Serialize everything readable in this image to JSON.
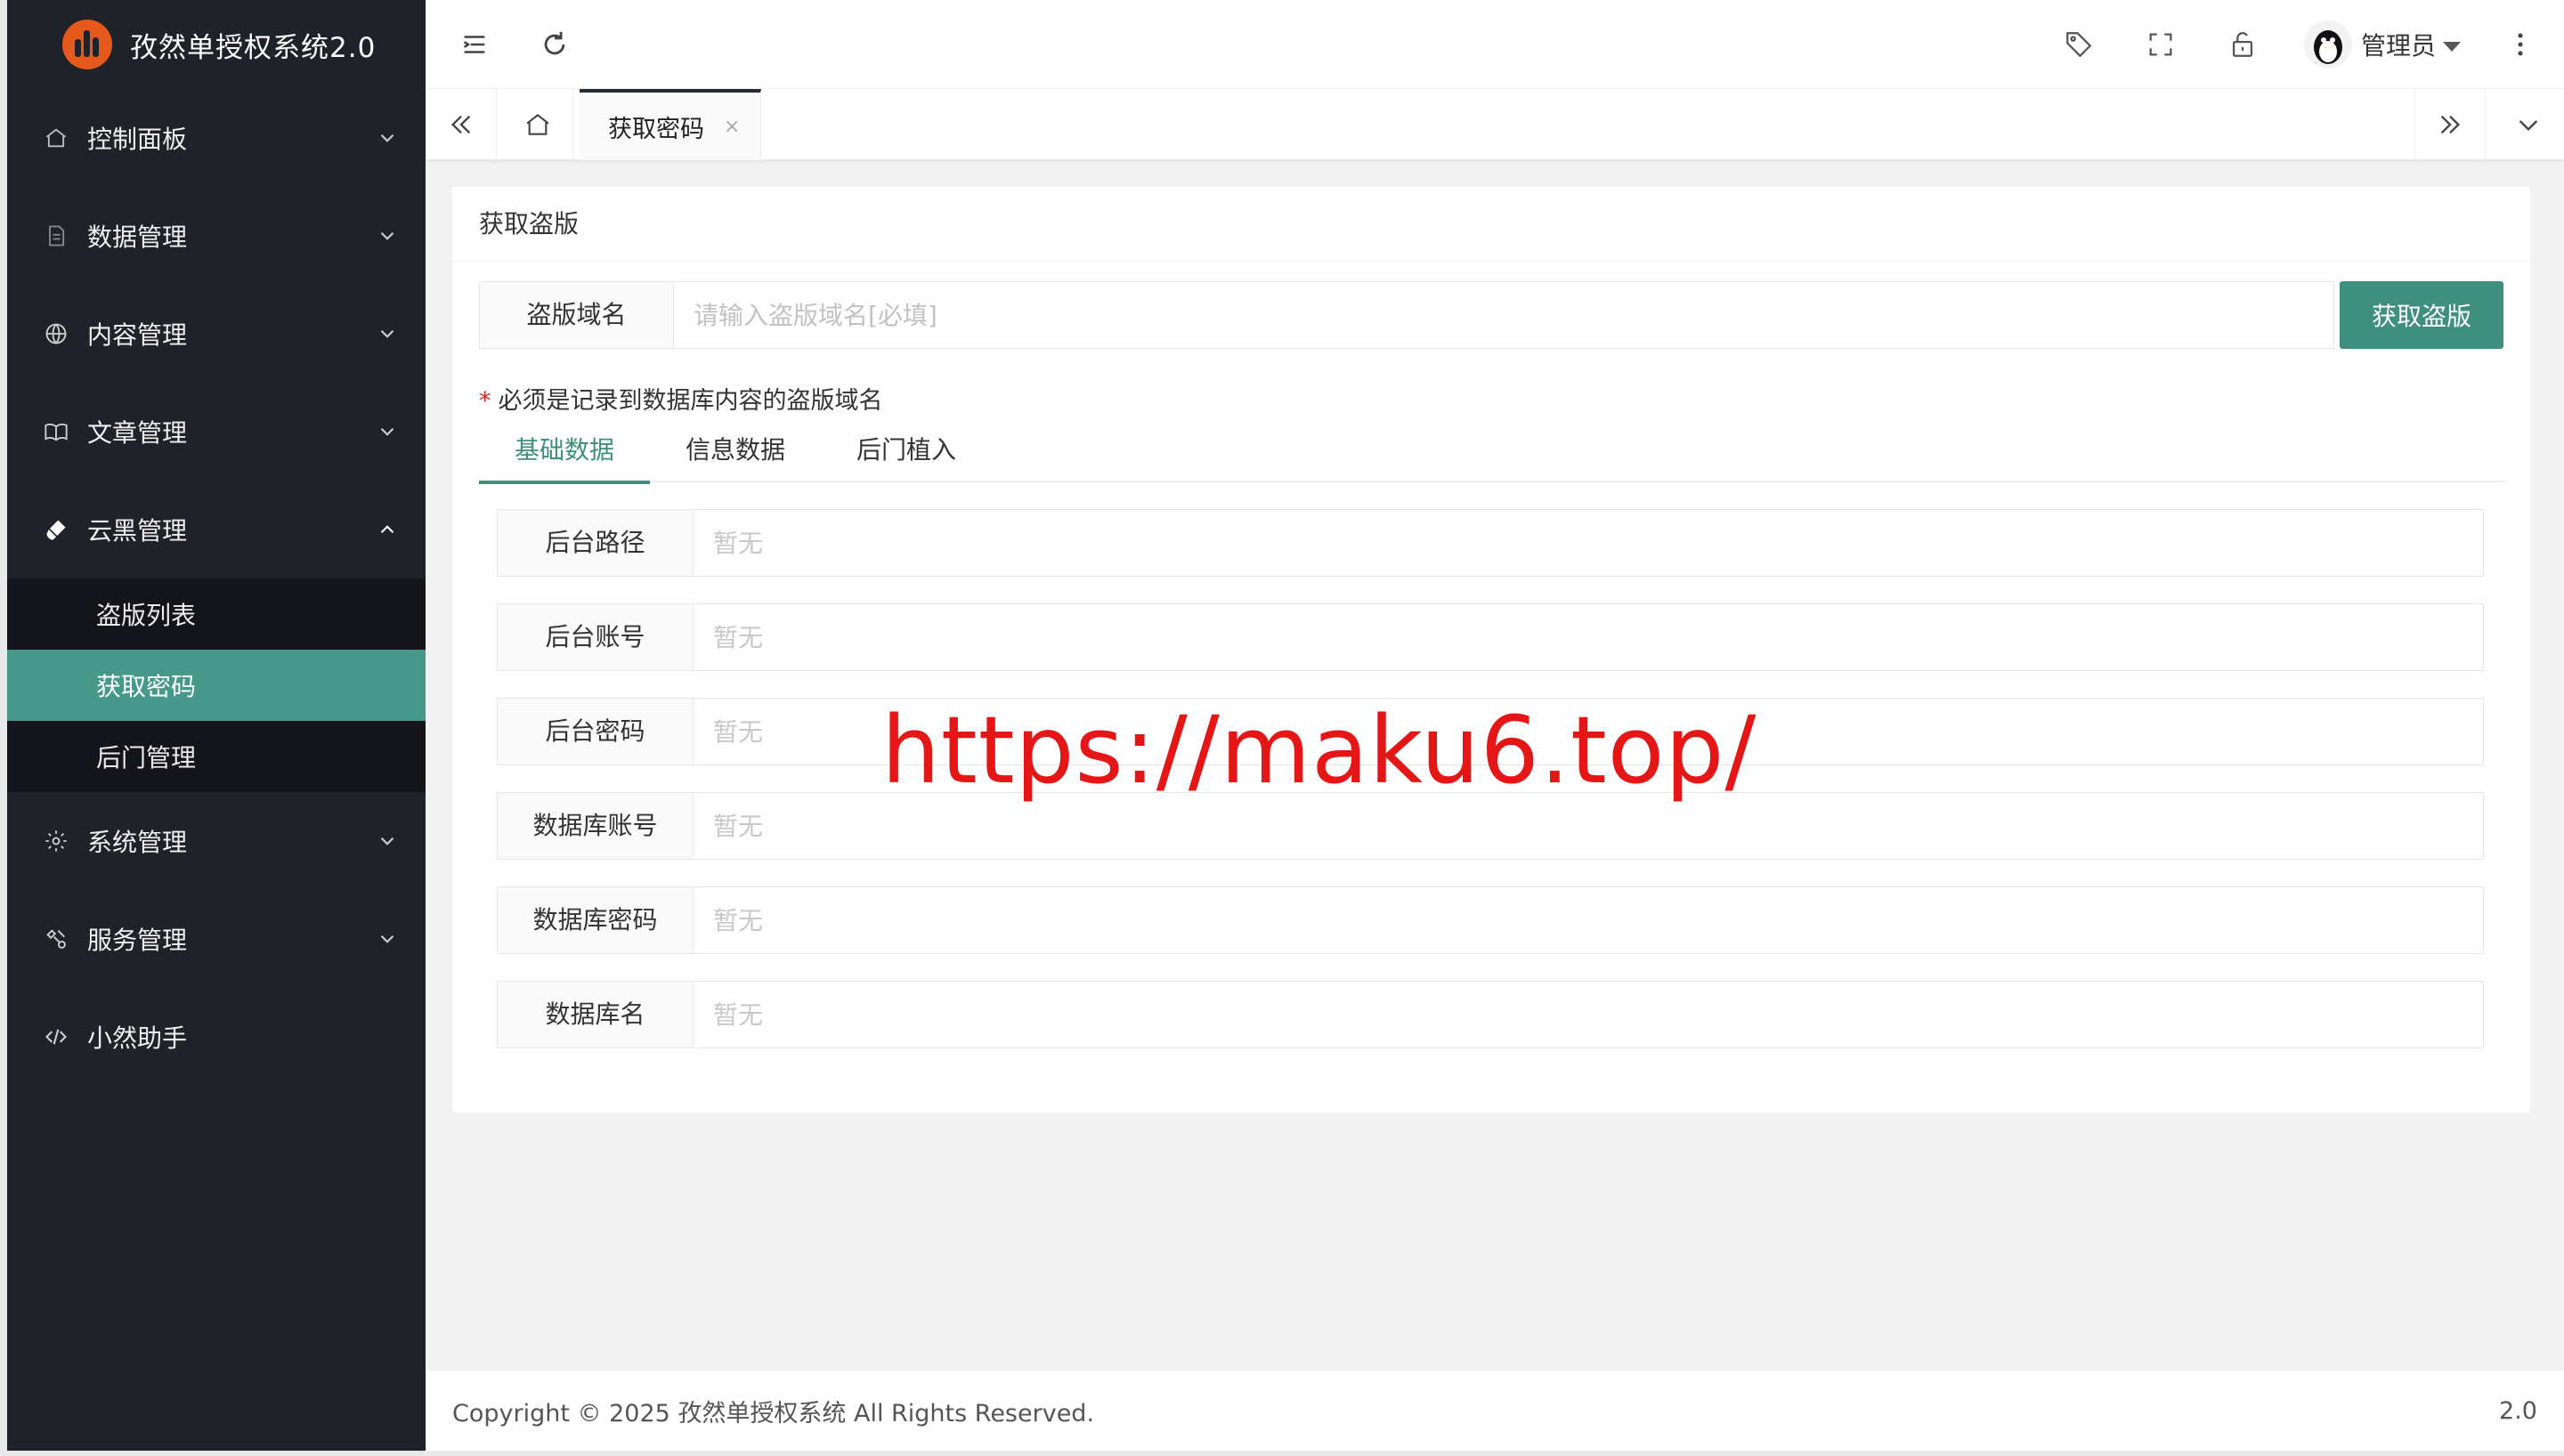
{
  "app": {
    "title": "孜然单授权系统2.0",
    "accent": "#45988a",
    "sidebar_bg": "#20222a"
  },
  "sidebar": {
    "items": [
      {
        "label": "控制面板",
        "icon": "home-icon",
        "expanded": false
      },
      {
        "label": "数据管理",
        "icon": "document-icon",
        "expanded": false
      },
      {
        "label": "内容管理",
        "icon": "globe-icon",
        "expanded": false
      },
      {
        "label": "文章管理",
        "icon": "book-icon",
        "expanded": false
      },
      {
        "label": "云黑管理",
        "icon": "brush-icon",
        "expanded": true,
        "children": [
          {
            "label": "盗版列表",
            "active": false
          },
          {
            "label": "获取密码",
            "active": true
          },
          {
            "label": "后门管理",
            "active": false
          }
        ]
      },
      {
        "label": "系统管理",
        "icon": "gear-icon",
        "expanded": false
      },
      {
        "label": "服务管理",
        "icon": "service-icon",
        "expanded": false
      },
      {
        "label": "小然助手",
        "icon": "code-icon",
        "expanded": false
      }
    ]
  },
  "header": {
    "user_name": "管理员",
    "icons": [
      "menu-toggle-icon",
      "refresh-icon",
      "tag-icon",
      "fullscreen-icon",
      "lock-icon",
      "more-icon"
    ]
  },
  "tabbar": {
    "current_tab": "获取密码",
    "close_glyph": "×"
  },
  "card": {
    "title": "获取盗版",
    "domain_label": "盗版域名",
    "domain_placeholder": "请输入盗版域名[必填]",
    "fetch_button": "获取盗版",
    "hint_star": "*",
    "hint_text": "必须是记录到数据库内容的盗版域名",
    "tabs": [
      {
        "label": "基础数据",
        "active": true
      },
      {
        "label": "信息数据",
        "active": false
      },
      {
        "label": "后门植入",
        "active": false
      }
    ],
    "fields": [
      {
        "label": "后台路径",
        "placeholder": "暂无"
      },
      {
        "label": "后台账号",
        "placeholder": "暂无"
      },
      {
        "label": "后台密码",
        "placeholder": "暂无"
      },
      {
        "label": "数据库账号",
        "placeholder": "暂无"
      },
      {
        "label": "数据库密码",
        "placeholder": "暂无"
      },
      {
        "label": "数据库名",
        "placeholder": "暂无"
      }
    ]
  },
  "watermark": "https://maku6.top/",
  "footer": {
    "copyright": "Copyright © 2025 孜然单授权系统 All Rights Reserved.",
    "version": "2.0"
  }
}
